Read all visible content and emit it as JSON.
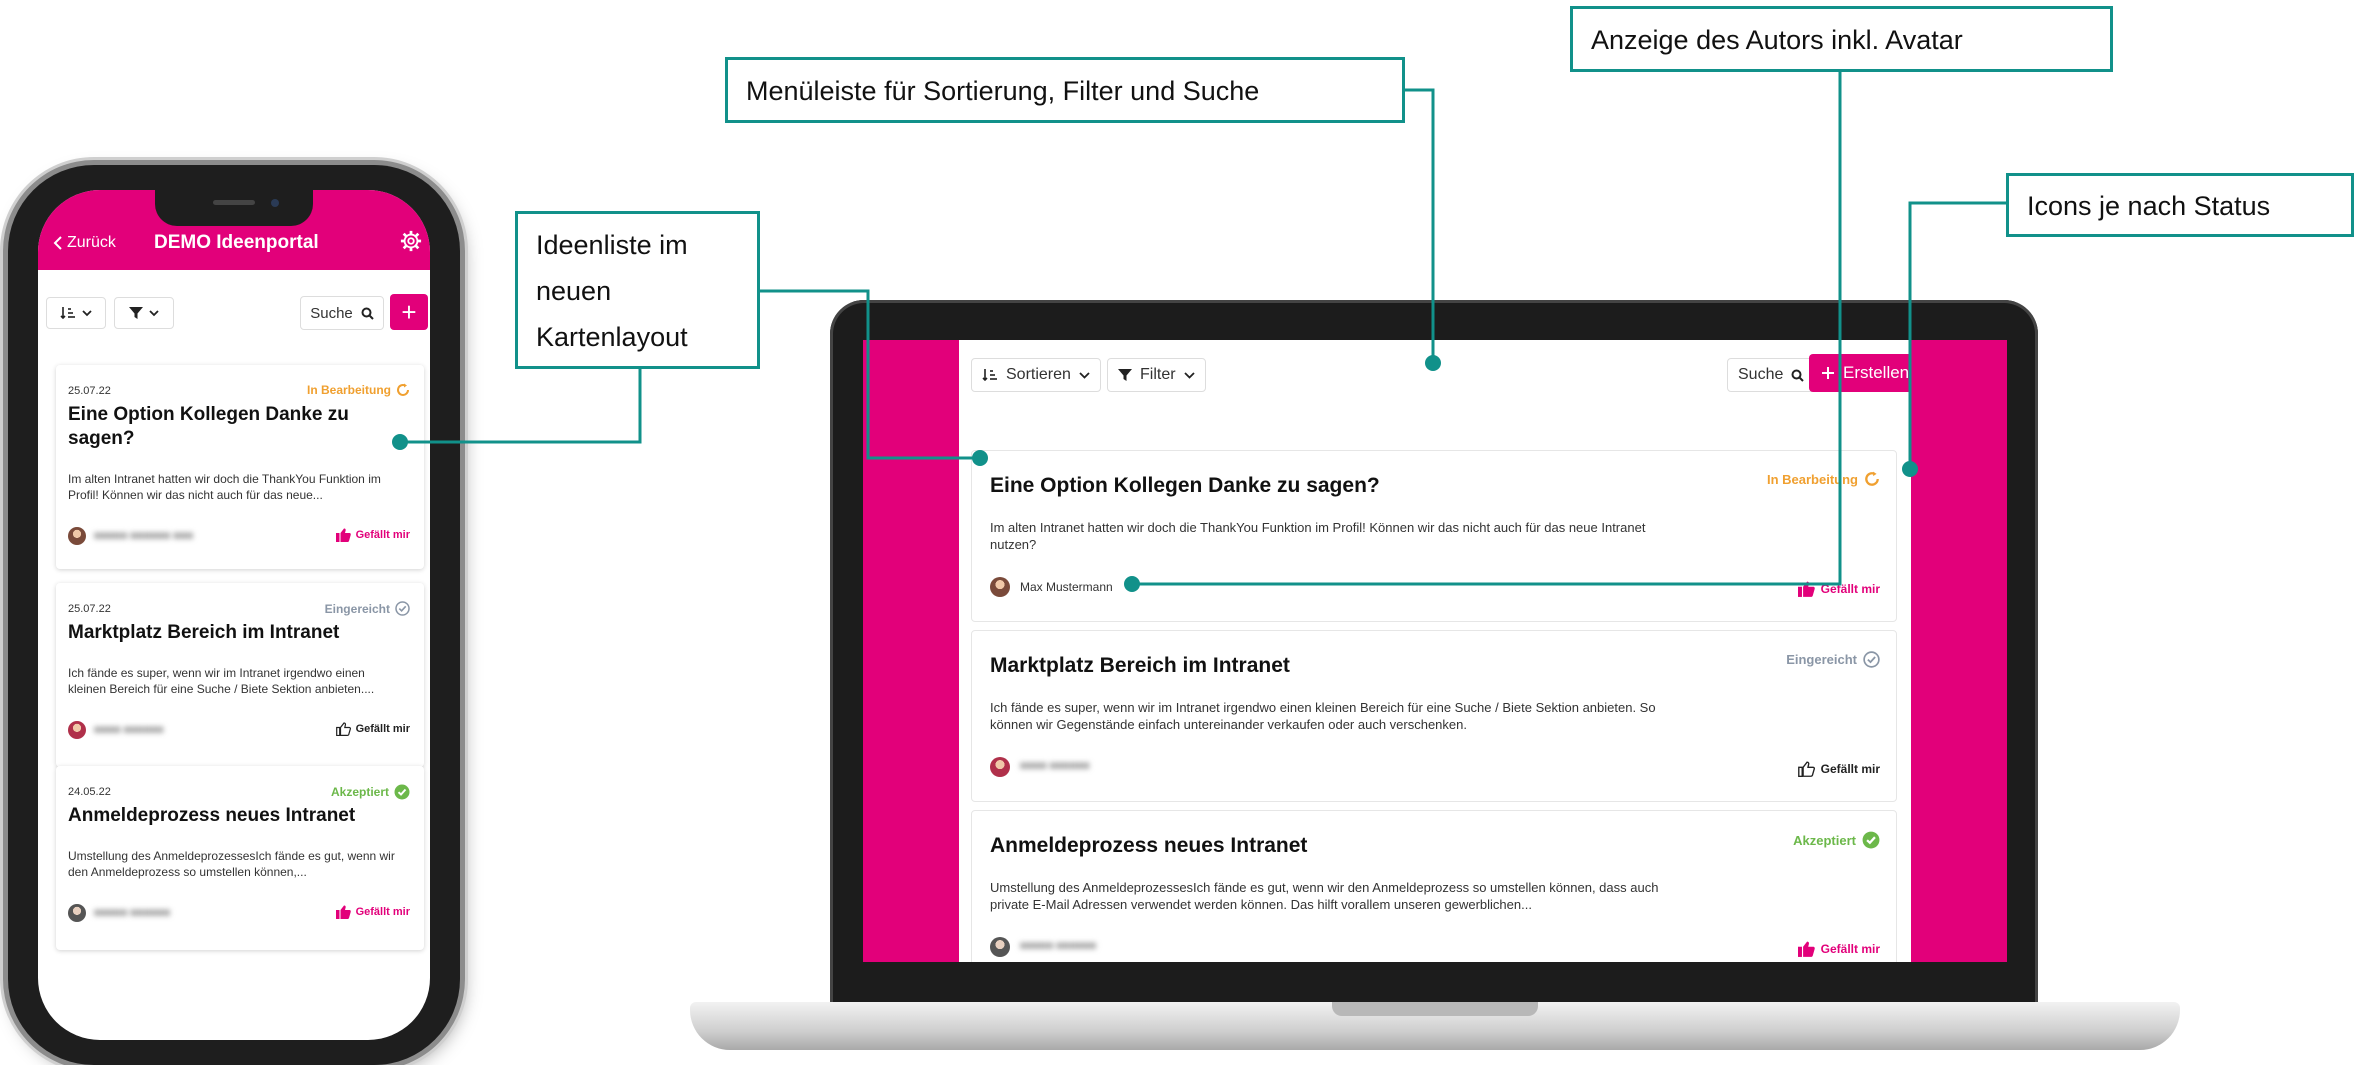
{
  "colors": {
    "brand": "#e2007a",
    "teal": "#11918a",
    "status_in_progress": "#f0a030",
    "status_submitted": "#8a96a6",
    "status_accepted": "#6cb84a"
  },
  "callouts": {
    "list": [
      "Ideenliste im",
      "neuen",
      "Kartenlayout"
    ],
    "menu": "Menüleiste für Sortierung, Filter und Suche",
    "author": "Anzeige des Autors inkl. Avatar",
    "icons": "Icons je nach Status"
  },
  "phone": {
    "back_label": "Zurück",
    "title": "DEMO Ideenportal",
    "search_label": "Suche",
    "add_label": "+",
    "cards": [
      {
        "date": "25.07.22",
        "status": "In Bearbeitung",
        "title": "Eine Option Kollegen Danke zu sagen?",
        "desc": "Im alten Intranet hatten wir doch die ThankYou Funktion im Profil! Können wir das nicht auch für das neue...",
        "like": "Gefällt mir"
      },
      {
        "date": "25.07.22",
        "status": "Eingereicht",
        "title": "Marktplatz Bereich im Intranet",
        "desc": "Ich fände es super, wenn wir im Intranet irgendwo einen kleinen Bereich für eine Suche / Biete Sektion anbieten....",
        "like": "Gefällt mir"
      },
      {
        "date": "24.05.22",
        "status": "Akzeptiert",
        "title": "Anmeldeprozess neues Intranet",
        "desc": "Umstellung des AnmeldeprozessesIch fände es gut, wenn wir den Anmeldeprozess so umstellen können,...",
        "like": "Gefällt mir"
      }
    ]
  },
  "laptop": {
    "sort_label": "Sortieren",
    "filter_label": "Filter",
    "search_label": "Suche",
    "create_label": "Erstellen",
    "cards": [
      {
        "title": "Eine Option Kollegen Danke zu sagen?",
        "status": "In Bearbeitung",
        "desc": "Im alten Intranet hatten wir doch die ThankYou Funktion im Profil! Können wir das nicht auch für das neue Intranet nutzen?",
        "author": "Max Mustermann",
        "like": "Gefällt mir"
      },
      {
        "title": "Marktplatz Bereich im Intranet",
        "status": "Eingereicht",
        "desc": "Ich fände es super, wenn wir im Intranet irgendwo einen kleinen Bereich für eine Suche / Biete Sektion anbieten. So können wir Gegenstände einfach untereinander verkaufen oder auch verschenken.",
        "like": "Gefällt mir"
      },
      {
        "title": "Anmeldeprozess neues Intranet",
        "status": "Akzeptiert",
        "desc": "Umstellung des AnmeldeprozessesIch fände es gut, wenn wir den Anmeldeprozess so umstellen können, dass auch private E-Mail Adressen verwendet werden können. Das hilft vorallem unseren gewerblichen...",
        "like": "Gefällt mir"
      }
    ]
  }
}
